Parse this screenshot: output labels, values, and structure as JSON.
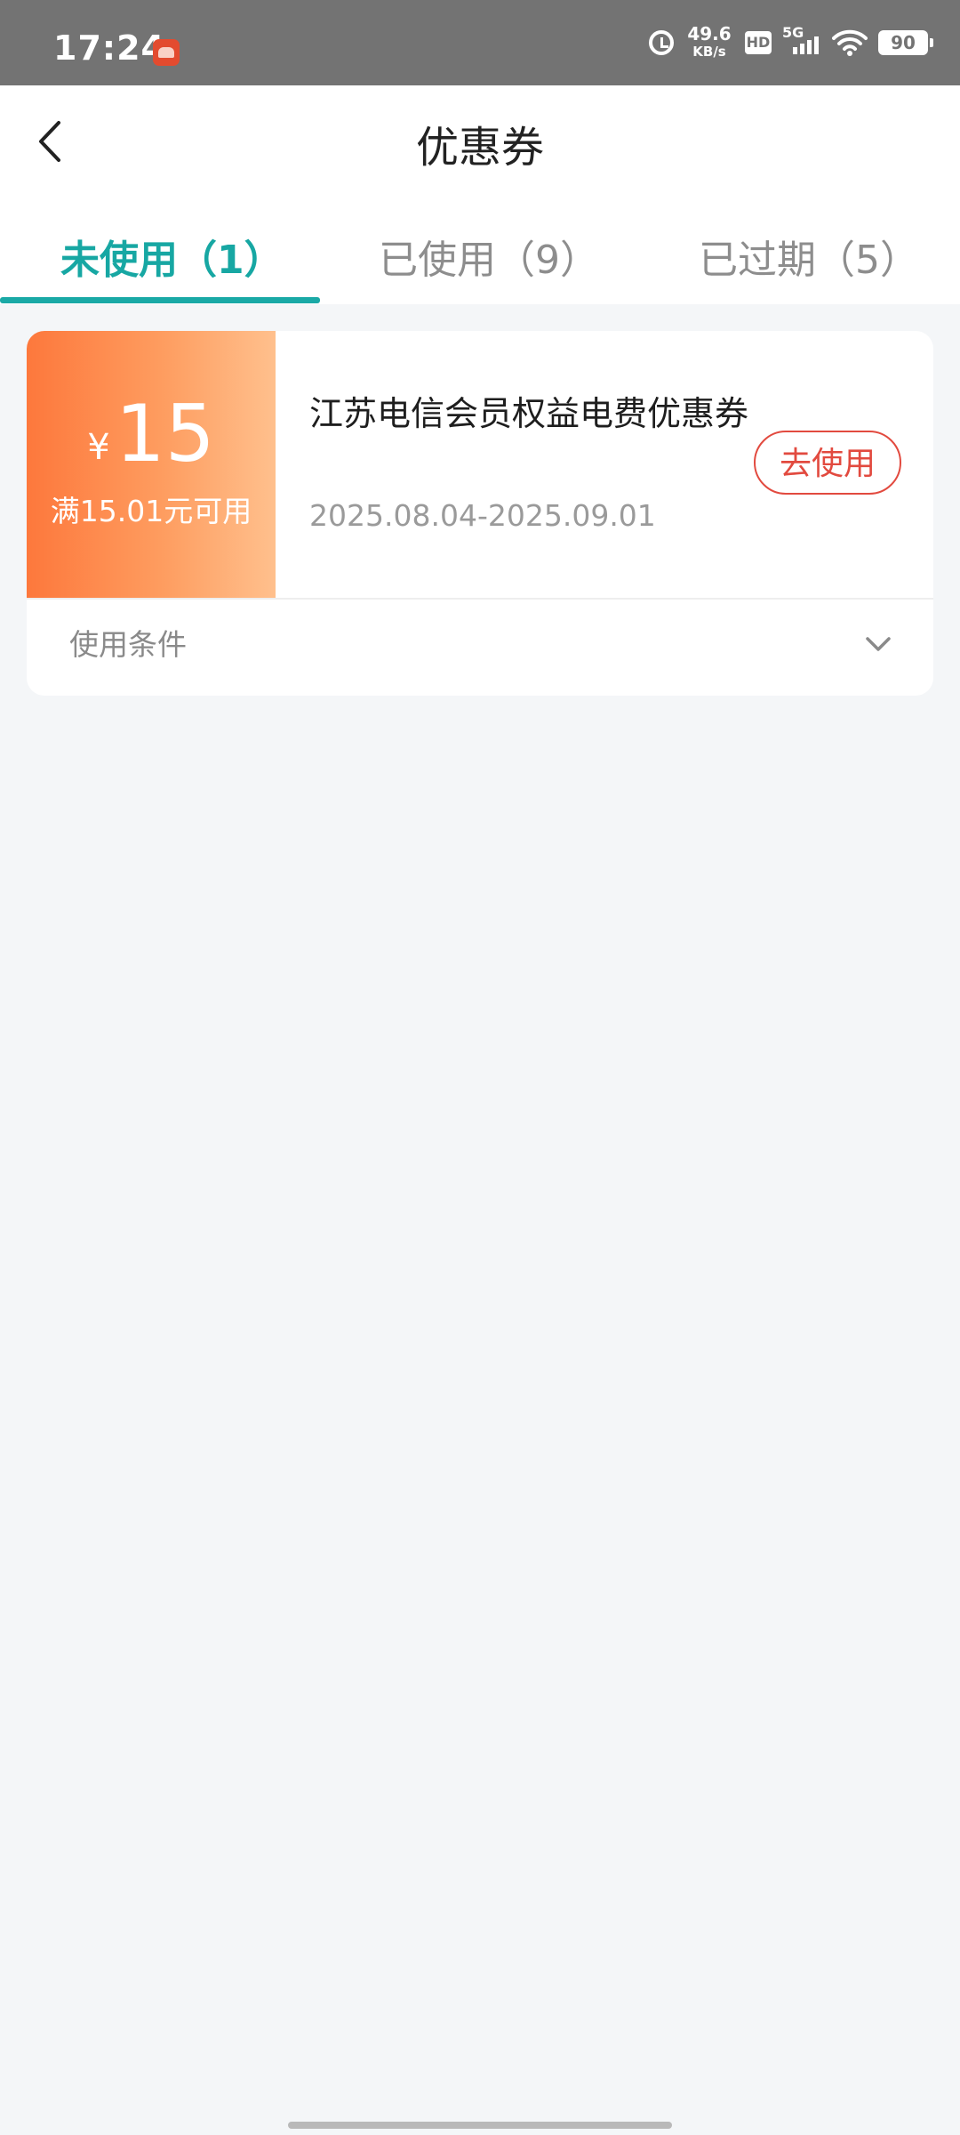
{
  "status_bar": {
    "time": "17:24",
    "net_speed_value": "49.6",
    "net_speed_unit": "KB/s",
    "hd_label": "HD",
    "network_label": "5G",
    "battery": "90"
  },
  "header": {
    "title": "优惠券"
  },
  "tabs": [
    {
      "label": "未使用（1）",
      "active": true
    },
    {
      "label": "已使用（9）",
      "active": false
    },
    {
      "label": "已过期（5）",
      "active": false
    }
  ],
  "coupon": {
    "currency_symbol": "¥",
    "amount": "15",
    "condition": "满15.01元可用",
    "name": "江苏电信会员权益电费优惠券",
    "validity": "2025.08.04-2025.09.01",
    "use_button_label": "去使用",
    "conditions_label": "使用条件"
  },
  "colors": {
    "accent": "#17a7a3",
    "coupon_orange": "#fd783c",
    "use_button": "#e24a3f"
  }
}
